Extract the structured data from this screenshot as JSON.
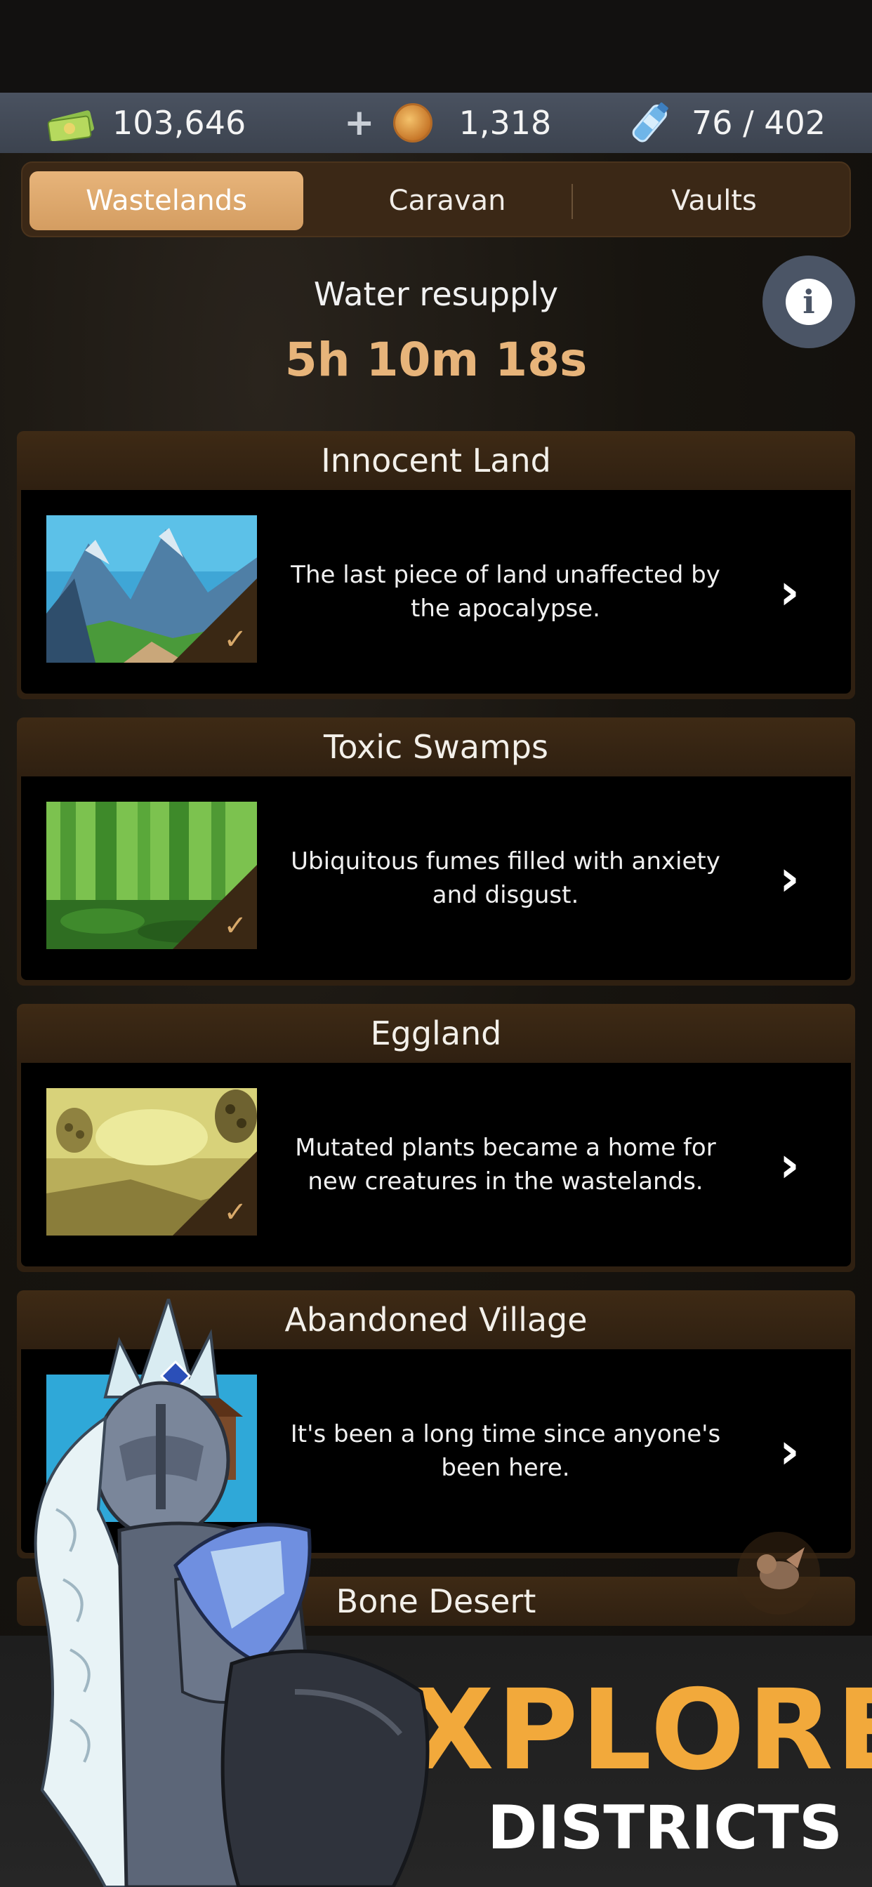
{
  "currency": {
    "cash": "103,646",
    "coins": "1,318",
    "water": "76 / 402",
    "plus_label": "+"
  },
  "icons": {
    "cash": "cash-icon",
    "coin": "coin-icon",
    "water": "water-bottle-icon",
    "info": "info-icon",
    "chevron": "chevron-right-icon",
    "check": "check-icon"
  },
  "tabs": [
    {
      "label": "Wastelands",
      "active": true
    },
    {
      "label": "Caravan",
      "active": false
    },
    {
      "label": "Vaults",
      "active": false
    }
  ],
  "resupply": {
    "title": "Water resupply",
    "time": "5h 10m 18s"
  },
  "districts": [
    {
      "name": "Innocent Land",
      "description": "The last piece of land unaffected by the apocalypse."
    },
    {
      "name": "Toxic Swamps",
      "description": "Ubiquitous fumes filled with anxiety and disgust."
    },
    {
      "name": "Eggland",
      "description": "Mutated plants became a home for new creatures in the wastelands."
    },
    {
      "name": "Abandoned Village",
      "description": "It's been a long time since anyone's been here."
    },
    {
      "name": "Bone Desert",
      "description": ""
    }
  ],
  "promo": {
    "line1": "EXPLORE",
    "line2": "DISTRICTS"
  },
  "colors": {
    "accent": "#e7b47a",
    "promo_orange": "#f2a93b",
    "card_header": "#2f2011",
    "currency_bar": "#434b58"
  }
}
